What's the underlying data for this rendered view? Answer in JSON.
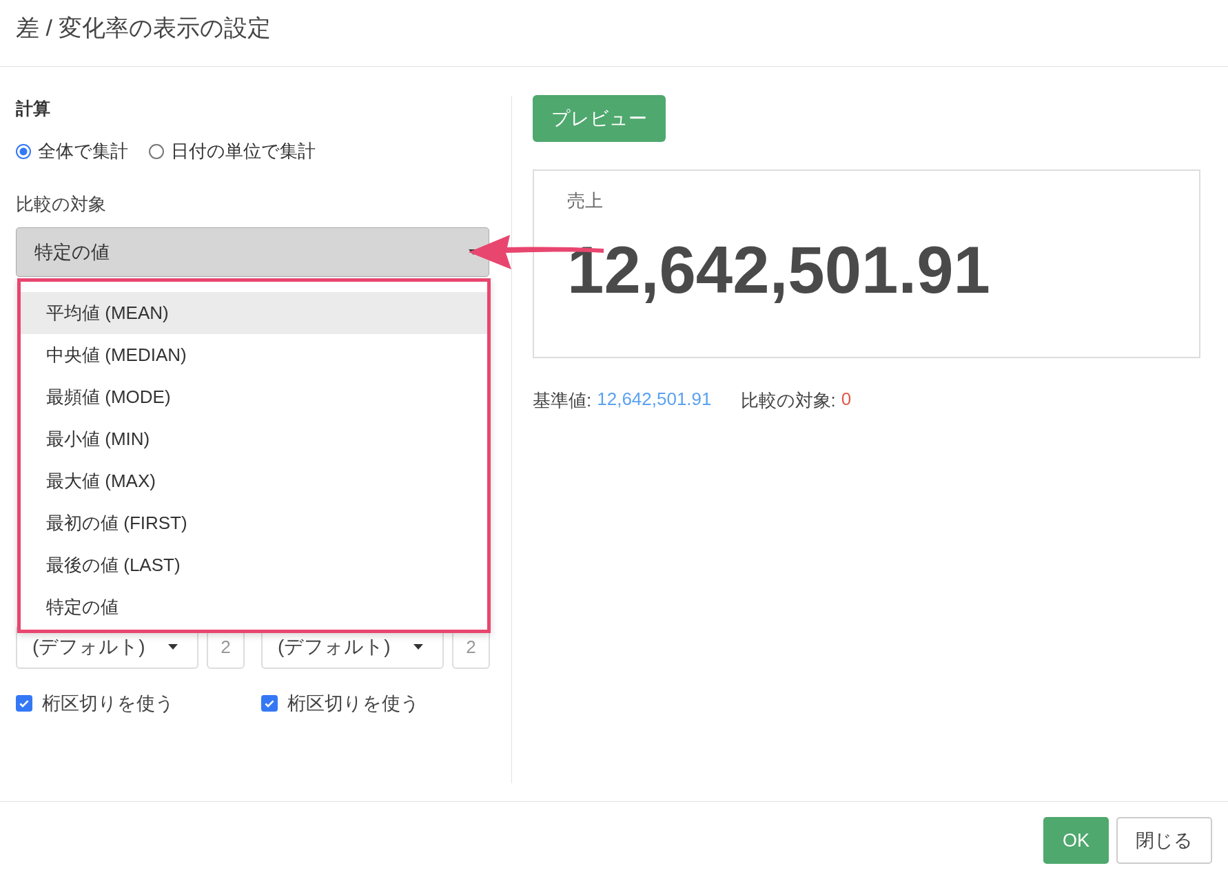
{
  "window": {
    "title": "差 / 変化率の表示の設定"
  },
  "calculation": {
    "heading": "計算",
    "options": [
      {
        "label": "全体で集計",
        "selected": true
      },
      {
        "label": "日付の単位で集計",
        "selected": false
      }
    ]
  },
  "compare": {
    "label": "比較の対象",
    "select": {
      "value": "特定の値"
    },
    "menu": {
      "items": [
        {
          "label": "平均値 (MEAN)",
          "highlighted": true
        },
        {
          "label": "中央値 (MEDIAN)",
          "highlighted": false
        },
        {
          "label": "最頻値 (MODE)",
          "highlighted": false
        },
        {
          "label": "最小値 (MIN)",
          "highlighted": false
        },
        {
          "label": "最大値 (MAX)",
          "highlighted": false
        },
        {
          "label": "最初の値 (FIRST)",
          "highlighted": false
        },
        {
          "label": "最後の値 (LAST)",
          "highlighted": false
        },
        {
          "label": "特定の値",
          "highlighted": false
        }
      ]
    }
  },
  "number_formats": [
    {
      "format": "(デフォルト)",
      "digits_placeholder": "2",
      "separator": {
        "label": "桁区切りを使う",
        "checked": true
      }
    },
    {
      "format": "(デフォルト)",
      "digits_placeholder": "2",
      "separator": {
        "label": "桁区切りを使う",
        "checked": true
      }
    }
  ],
  "preview": {
    "button": "プレビュー",
    "card": {
      "label": "売上",
      "value": "12,642,501.91"
    },
    "summary": {
      "base_label": "基準値:",
      "base_value": "12,642,501.91",
      "compare_label": "比較の対象:",
      "compare_value": "0"
    }
  },
  "footer": {
    "buttons": [
      {
        "label": "OK",
        "kind": "primary"
      },
      {
        "label": "閉じる",
        "kind": "default"
      }
    ]
  }
}
